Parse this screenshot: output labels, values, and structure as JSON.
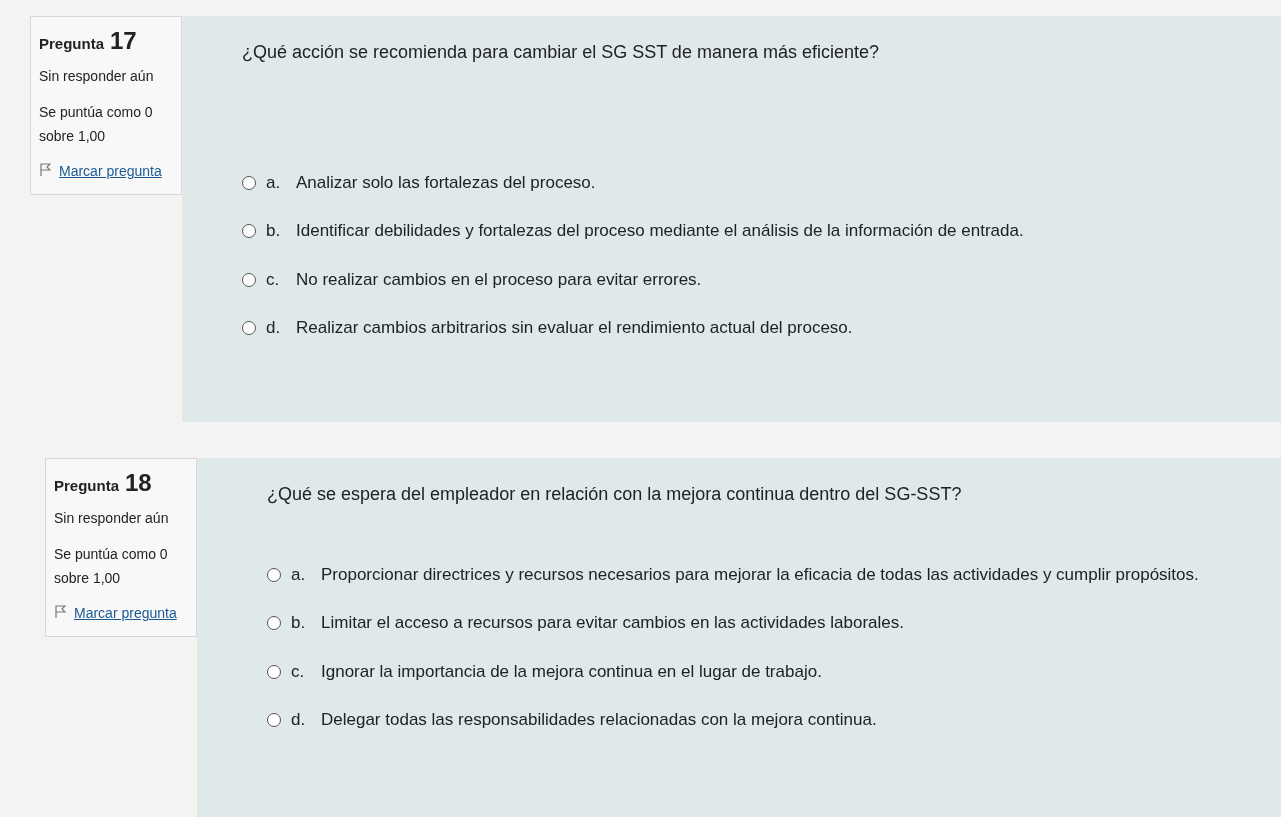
{
  "questions": [
    {
      "label": "Pregunta",
      "number": "17",
      "status": "Sin responder aún",
      "score": "Se puntúa como 0 sobre 1,00",
      "flag": "Marcar pregunta",
      "text": "¿Qué acción se recomienda para cambiar el SG SST de manera más eficiente?",
      "options": [
        {
          "letter": "a.",
          "text": "Analizar solo las fortalezas del proceso.",
          "selected": false
        },
        {
          "letter": "b.",
          "text": "Identificar debilidades y fortalezas del proceso mediante el análisis de la información de entrada.",
          "selected": false
        },
        {
          "letter": "c.",
          "text": "No realizar cambios en el proceso para evitar errores.",
          "selected": false
        },
        {
          "letter": "d.",
          "text": "Realizar cambios arbitrarios sin evaluar el rendimiento actual del proceso.",
          "selected": false
        }
      ]
    },
    {
      "label": "Pregunta",
      "number": "18",
      "status": "Sin responder aún",
      "score": "Se puntúa como 0 sobre 1,00",
      "flag": "Marcar pregunta",
      "text": "¿Qué se espera del empleador en relación con la mejora continua dentro del SG-SST?",
      "options": [
        {
          "letter": "a.",
          "text": "Proporcionar directrices y recursos necesarios para mejorar la eficacia de todas las actividades y cumplir propósitos.",
          "selected": false
        },
        {
          "letter": "b.",
          "text": "Limitar el acceso a recursos para evitar cambios en las actividades laborales.",
          "selected": false
        },
        {
          "letter": "c.",
          "text": "Ignorar la importancia de la mejora continua en el lugar de trabajo.",
          "selected": false
        },
        {
          "letter": "d.",
          "text": "Delegar todas las responsabilidades relacionadas con la mejora continua.",
          "selected": false
        }
      ]
    }
  ]
}
